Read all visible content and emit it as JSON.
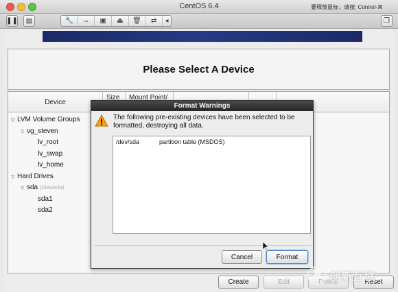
{
  "window": {
    "title": "CentOS 6.4",
    "release_hint": "要释放鼠标，请按: Control-⌘"
  },
  "toolbar": {
    "icons": [
      "pause-icon",
      "settings-icon",
      "wrench-icon",
      "arrows-icon",
      "disk-icon",
      "lock-icon",
      "trash-icon",
      "network-icon",
      "chevron-left-icon",
      "window-icon"
    ]
  },
  "installer": {
    "page_title": "Please Select A Device",
    "columns": {
      "device": "Device",
      "size": "Size",
      "mount": "Mount Point/"
    },
    "tree": [
      {
        "label": "LVM Volume Groups",
        "level": 0,
        "expanded": true
      },
      {
        "label": "vg_steven",
        "level": 1,
        "expanded": true
      },
      {
        "label": "lv_root",
        "level": 2
      },
      {
        "label": "lv_swap",
        "level": 2
      },
      {
        "label": "lv_home",
        "level": 2
      },
      {
        "label": "Hard Drives",
        "level": 0,
        "expanded": true
      },
      {
        "label": "sda",
        "sub": "(/dev/sda)",
        "level": 1,
        "expanded": true
      },
      {
        "label": "sda1",
        "level": 2
      },
      {
        "label": "sda2",
        "level": 2
      }
    ],
    "buttons": {
      "create": "Create",
      "edit": "Edit",
      "delete": "Delete",
      "reset": "Reset"
    }
  },
  "dialog": {
    "title": "Format Warnings",
    "message": "The following pre-existing devices have been selected to be formatted, destroying all data.",
    "devices": [
      {
        "device": "/dev/sda",
        "description": "partition table (MSDOS)"
      }
    ],
    "cancel_label": "Cancel",
    "format_label": "Format"
  },
  "watermark": {
    "text": "创新互联"
  }
}
